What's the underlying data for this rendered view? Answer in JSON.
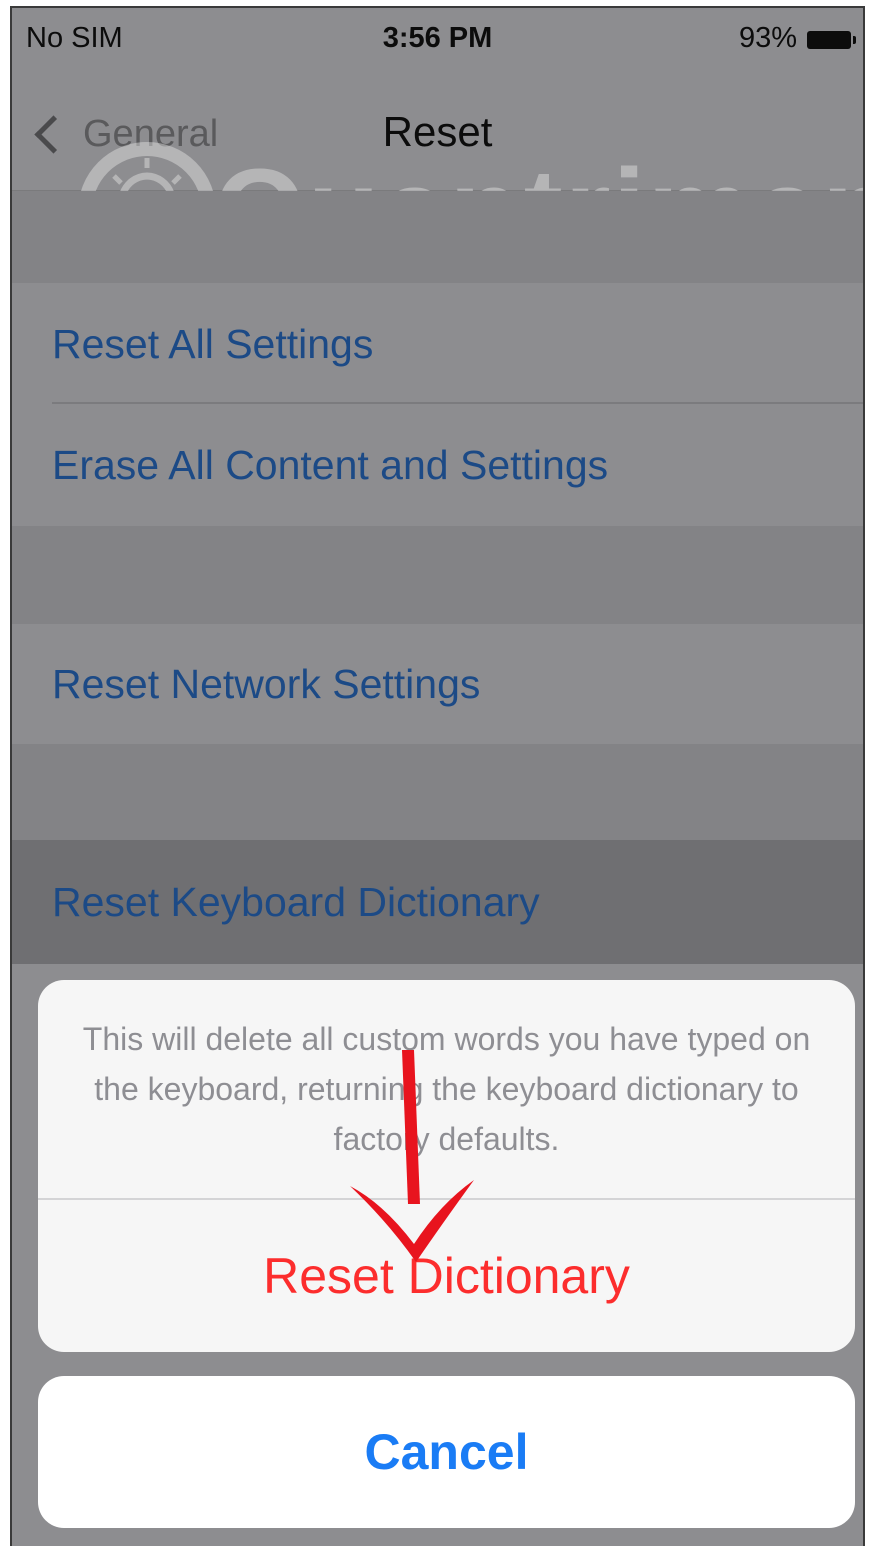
{
  "status_bar": {
    "carrier": "No SIM",
    "time": "3:56 PM",
    "battery": "93%"
  },
  "nav": {
    "back_label": "General",
    "title": "Reset"
  },
  "watermark": "Quantrimang",
  "rows": [
    {
      "label": "Reset All Settings"
    },
    {
      "label": "Erase All Content and Settings"
    },
    {
      "label": "Reset Network Settings"
    },
    {
      "label": "Reset Keyboard Dictionary"
    }
  ],
  "action_sheet": {
    "message": "This will delete all custom words you have typed on the keyboard, returning the keyboard dictionary to factory defaults.",
    "action_label": "Reset Dictionary",
    "cancel_label": "Cancel"
  },
  "colors": {
    "destructive": "#fc2d2d",
    "link_blue": "#1a7cf5",
    "annotation_arrow": "#e8141e"
  }
}
